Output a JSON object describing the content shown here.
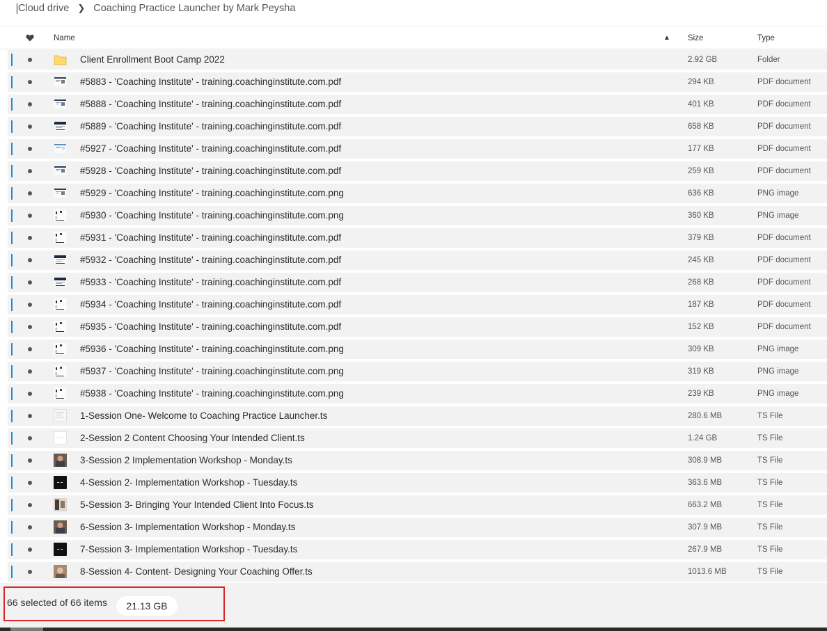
{
  "breadcrumb": {
    "root": "Cloud drive",
    "current": "Coaching Practice Launcher by Mark Peysha"
  },
  "columns": {
    "name": "Name",
    "size": "Size",
    "type": "Type"
  },
  "rows": [
    {
      "name": "Client Enrollment Boot Camp 2022",
      "size": "2.92 GB",
      "type": "Folder",
      "icon": "folder"
    },
    {
      "name": "#5883 - 'Coaching Institute' - training.coachinginstitute.com.pdf",
      "size": "294 KB",
      "type": "PDF document",
      "icon": "doc"
    },
    {
      "name": "#5888 - 'Coaching Institute' - training.coachinginstitute.com.pdf",
      "size": "401 KB",
      "type": "PDF document",
      "icon": "doc"
    },
    {
      "name": "#5889 - 'Coaching Institute' - training.coachinginstitute.com.pdf",
      "size": "658 KB",
      "type": "PDF document",
      "icon": "doc-dark"
    },
    {
      "name": "#5927 - 'Coaching Institute' - training.coachinginstitute.com.pdf",
      "size": "177 KB",
      "type": "PDF document",
      "icon": "doc-blue"
    },
    {
      "name": "#5928 - 'Coaching Institute' - training.coachinginstitute.com.pdf",
      "size": "259 KB",
      "type": "PDF document",
      "icon": "doc"
    },
    {
      "name": "#5929 - 'Coaching Institute' - training.coachinginstitute.com.png",
      "size": "636 KB",
      "type": "PNG image",
      "icon": "doc"
    },
    {
      "name": "#5930 - 'Coaching Institute' - training.coachinginstitute.com.png",
      "size": "360 KB",
      "type": "PNG image",
      "icon": "doc-sparse"
    },
    {
      "name": "#5931 - 'Coaching Institute' - training.coachinginstitute.com.pdf",
      "size": "379 KB",
      "type": "PDF document",
      "icon": "doc-sparse"
    },
    {
      "name": "#5932 - 'Coaching Institute' - training.coachinginstitute.com.pdf",
      "size": "245 KB",
      "type": "PDF document",
      "icon": "doc-dark"
    },
    {
      "name": "#5933 - 'Coaching Institute' - training.coachinginstitute.com.pdf",
      "size": "268 KB",
      "type": "PDF document",
      "icon": "doc-dark"
    },
    {
      "name": "#5934 - 'Coaching Institute' - training.coachinginstitute.com.pdf",
      "size": "187 KB",
      "type": "PDF document",
      "icon": "doc-sparse"
    },
    {
      "name": "#5935 - 'Coaching Institute' - training.coachinginstitute.com.pdf",
      "size": "152 KB",
      "type": "PDF document",
      "icon": "doc-sparse"
    },
    {
      "name": "#5936 - 'Coaching Institute' - training.coachinginstitute.com.png",
      "size": "309 KB",
      "type": "PNG image",
      "icon": "doc-sparse"
    },
    {
      "name": "#5937 - 'Coaching Institute' - training.coachinginstitute.com.png",
      "size": "319 KB",
      "type": "PNG image",
      "icon": "doc-sparse"
    },
    {
      "name": "#5938 - 'Coaching Institute' - training.coachinginstitute.com.png",
      "size": "239 KB",
      "type": "PNG image",
      "icon": "doc-sparse"
    },
    {
      "name": "1-Session One- Welcome to Coaching Practice Launcher.ts",
      "size": "280.6 MB",
      "type": "TS File",
      "icon": "video-light"
    },
    {
      "name": "2-Session 2 Content Choosing Your Intended Client.ts",
      "size": "1.24 GB",
      "type": "TS File",
      "icon": "video-blank"
    },
    {
      "name": "3-Session 2 Implementation Workshop - Monday.ts",
      "size": "308.9 MB",
      "type": "TS File",
      "icon": "video-photo"
    },
    {
      "name": "4-Session 2- Implementation Workshop - Tuesday.ts",
      "size": "363.6 MB",
      "type": "TS File",
      "icon": "video-black"
    },
    {
      "name": "5-Session 3- Bringing Your Intended Client Into Focus.ts",
      "size": "663.2 MB",
      "type": "TS File",
      "icon": "video-photo2"
    },
    {
      "name": "6-Session 3- Implementation Workshop - Monday.ts",
      "size": "307.9 MB",
      "type": "TS File",
      "icon": "video-photo"
    },
    {
      "name": "7-Session 3- Implementation Workshop - Tuesday.ts",
      "size": "267.9 MB",
      "type": "TS File",
      "icon": "video-black"
    },
    {
      "name": "8-Session 4- Content- Designing Your Coaching Offer.ts",
      "size": "1013.6 MB",
      "type": "TS File",
      "icon": "video-photo3"
    }
  ],
  "footer": {
    "selection_text": "66 selected of 66 items",
    "total_size": "21.13 GB"
  },
  "colors": {
    "accent": "#1f8bd6",
    "highlight_border": "#d9262a",
    "row_bg": "#f2f2f2",
    "folder": "#ffd96b"
  }
}
